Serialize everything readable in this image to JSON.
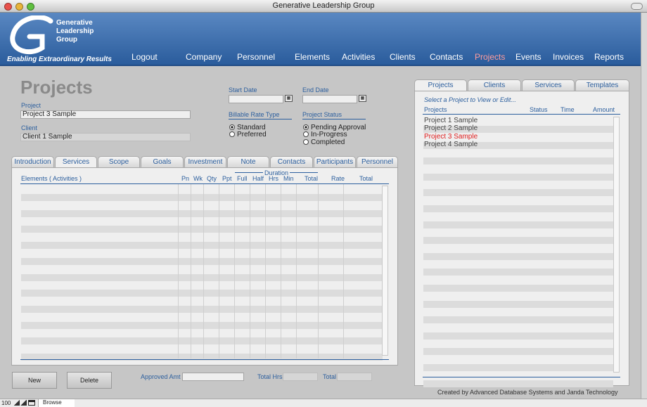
{
  "window": {
    "title": "Generative Leadership Group"
  },
  "header": {
    "logo_lines": [
      "Generative",
      "Leadership",
      "Group"
    ],
    "tagline": "Enabling Extraordinary Results",
    "nav": [
      "Logout",
      "Company",
      "Personnel",
      "Elements",
      "Activities",
      "Clients",
      "Contacts",
      "Projects",
      "Events",
      "Invoices",
      "Reports"
    ],
    "active_nav": "Projects"
  },
  "form": {
    "page_title": "Projects",
    "project_label": "Project",
    "project_value": "Project 3 Sample",
    "client_label": "Client",
    "client_value": "Client 1 Sample",
    "start_date_label": "Start Date",
    "start_date_value": "",
    "end_date_label": "End Date",
    "end_date_value": "",
    "billable_label": "Billable Rate Type",
    "billable_options": [
      "Standard",
      "Preferred"
    ],
    "billable_selected": "Standard",
    "status_label": "Project Status",
    "status_options": [
      "Pending Approval",
      "In-Progress",
      "Completed"
    ],
    "status_selected": "Pending Approval"
  },
  "services": {
    "tabs": [
      "Introduction",
      "Services",
      "Scope",
      "Goals",
      "Investment",
      "Note",
      "Contacts",
      "Participants",
      "Personnel"
    ],
    "active_tab": "Services",
    "duration_label": "Duration",
    "columns": [
      "Elements  ( Activities )",
      "Pn",
      "Wk",
      "Qty",
      "Ppt",
      "Full",
      "Half",
      "Hrs",
      "Min",
      "Total",
      "Rate",
      "Total"
    ],
    "rows": []
  },
  "footer_left": {
    "new_button": "New",
    "delete_button": "Delete",
    "approved_label": "Approved Amt",
    "approved_value": "",
    "total_hrs_label": "Total Hrs",
    "total_hrs_value": "",
    "total_label": "Total",
    "total_value": ""
  },
  "right_panel": {
    "tabs": [
      "Projects",
      "Clients",
      "Services",
      "Templates"
    ],
    "active_tab": "Projects",
    "instruction": "Select a Project to View or Edit...",
    "columns": [
      "Projects",
      "Status",
      "Time",
      "Amount"
    ],
    "items": [
      {
        "name": "Project 1 Sample",
        "selected": false
      },
      {
        "name": "Project 2 Sample",
        "selected": false
      },
      {
        "name": "Project 3 Sample",
        "selected": true
      },
      {
        "name": "Project 4 Sample",
        "selected": false
      }
    ],
    "credit": "Created by Advanced Database Systems and Janda Technology"
  },
  "status_bar": {
    "zoom": "100",
    "mode": "Browse"
  },
  "colors": {
    "header_blue": "#2a5c9c",
    "label_blue": "#2c5f9e",
    "active_nav": "#ff9c9c",
    "selected_item": "#e02020"
  }
}
